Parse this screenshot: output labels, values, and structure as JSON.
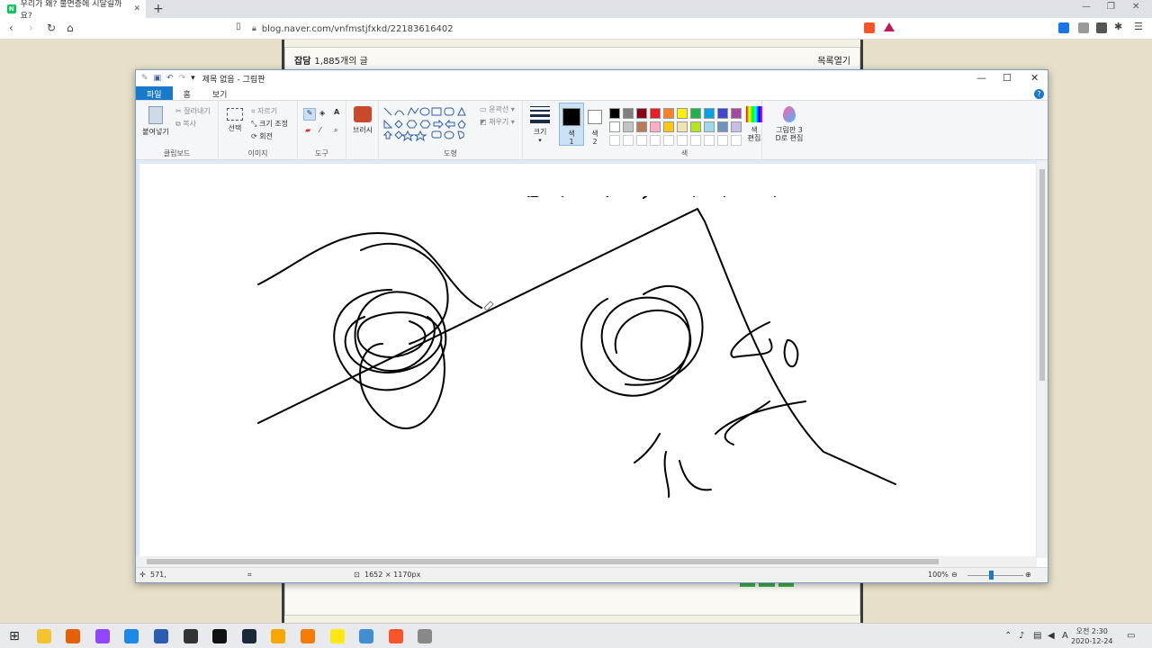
{
  "browser": {
    "tab_title": "우리가 왜? 불면증에 시달릴까요?",
    "tab_favicon": "N",
    "url": "blog.naver.com/vnfmstjfxkd/221836164​02",
    "url_display": "blog.naver.com/vnfmstjfxkd/221836164​02",
    "brave_badge": "3",
    "extensions": [
      "brave-shield-icon",
      "brave-rewards-icon",
      "translate-icon",
      "shield-icon",
      "puzzle-icon",
      "menu-icon"
    ]
  },
  "blog": {
    "category": "잡담",
    "post_count": "1,885개의 글",
    "list_toggle": "목록열기"
  },
  "paint": {
    "window_title": "제목 없음 - 그림판",
    "tabs": {
      "file": "파일",
      "home": "홈",
      "view": "보기"
    },
    "clipboard": {
      "paste": "붙여넣기",
      "cut": "잘라내기",
      "copy": "복사",
      "label": "클립보드"
    },
    "image": {
      "select": "선택",
      "crop": "자르기",
      "resize": "크기 조정",
      "rotate": "회전",
      "label": "이미지"
    },
    "tools": {
      "label": "도구"
    },
    "brushes": {
      "label": "브러시"
    },
    "shapes": {
      "outline": "윤곽선",
      "fill": "채우기",
      "label": "도형"
    },
    "size": {
      "label": "크기"
    },
    "color1": {
      "label_top": "색",
      "label_bottom": "1"
    },
    "color2": {
      "label_top": "색",
      "label_bottom": "2"
    },
    "edit_colors": {
      "label_top": "색",
      "label_bottom": "편집"
    },
    "paint3d": {
      "label_top": "그림판 3",
      "label_bottom": "D로 편집"
    },
    "colors_label": "색",
    "palette_row1": [
      "#000000",
      "#7f7f7f",
      "#880015",
      "#ed1c24",
      "#ff7f27",
      "#fff200",
      "#22b14c",
      "#00a2e8",
      "#3f48cc",
      "#a349a4"
    ],
    "palette_row2": [
      "#ffffff",
      "#c3c3c3",
      "#b97a57",
      "#ffaec9",
      "#ffc90e",
      "#efe4b0",
      "#b5e61d",
      "#99d9ea",
      "#7092be",
      "#c8bfe7"
    ],
    "status": {
      "cursor_pos": "571,",
      "image_size": "1652 × 1170px",
      "zoom": "100%"
    }
  },
  "taskbar": {
    "time": "오전 2:30",
    "date": "2020-12-24",
    "ime": "A",
    "icons": [
      "start-icon",
      "file-explorer-icon",
      "firefox-icon",
      "twitch-icon",
      "ccleaner-icon",
      "settings-icon",
      "obs-icon",
      "github-icon",
      "steam-icon",
      "winamp-icon",
      "vlc-icon",
      "kakao-icon",
      "qbittorrent-icon",
      "brave-icon",
      "paint-icon"
    ]
  }
}
